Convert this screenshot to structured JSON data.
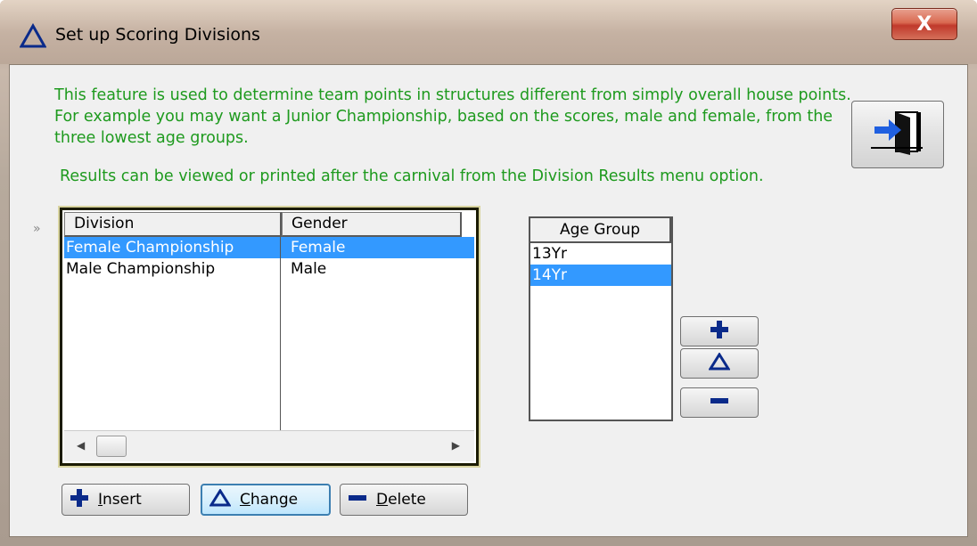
{
  "window": {
    "title": "Set up Scoring Divisions",
    "close_glyph": "X"
  },
  "info": {
    "paragraph": "This feature is used to determine team points in structures different from simply overall house points.  For example you may want a Junior Championship, based on the scores, male and female, from the three lowest age groups.",
    "results_note": "Results can be viewed or printed after the carnival from the Division Results menu option."
  },
  "row_indicator": "»",
  "divisions": {
    "columns": [
      "Division",
      "Gender"
    ],
    "rows": [
      {
        "division": "Female Championship",
        "gender": "Female",
        "selected": true
      },
      {
        "division": "Male Championship",
        "gender": "Male",
        "selected": false
      }
    ]
  },
  "age_groups": {
    "header": "Age Group",
    "rows": [
      {
        "label": "13Yr",
        "selected": false
      },
      {
        "label": "14Yr",
        "selected": true
      }
    ]
  },
  "buttons": {
    "insert": {
      "accel": "I",
      "rest": "nsert"
    },
    "change": {
      "accel": "C",
      "rest": "hange"
    },
    "delete": {
      "accel": "D",
      "rest": "elete"
    }
  },
  "colors": {
    "info_text": "#1e9a1e",
    "selection": "#3399ff",
    "icon_blue": "#0a2a8a"
  },
  "icons": {
    "title": "triangle-icon",
    "exit": "exit-door-icon",
    "add": "plus-icon",
    "change": "triangle-icon",
    "remove": "minus-icon"
  }
}
